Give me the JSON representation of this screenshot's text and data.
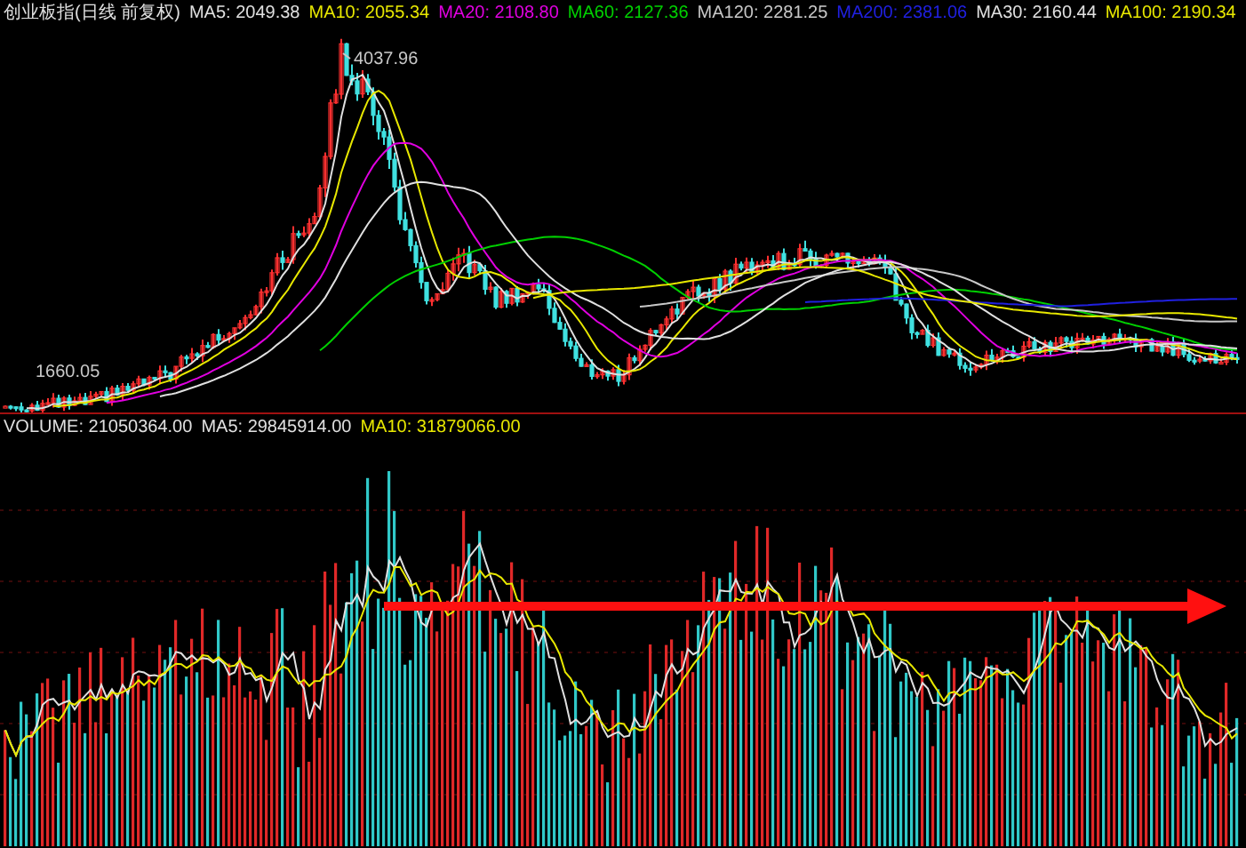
{
  "price_panel": {
    "title": "创业板指(日线 前复权)",
    "indicators": [
      {
        "label": "MA5:",
        "value": "2049.38",
        "color": "#e0e0e0"
      },
      {
        "label": "MA10:",
        "value": "2055.34",
        "color": "#e8e800"
      },
      {
        "label": "MA20:",
        "value": "2108.80",
        "color": "#e000e0"
      },
      {
        "label": "MA60:",
        "value": "2127.36",
        "color": "#00d000"
      },
      {
        "label": "MA120:",
        "value": "2281.25",
        "color": "#c8c8c8"
      },
      {
        "label": "MA200:",
        "value": "2381.06",
        "color": "#2020e0"
      },
      {
        "label": "MA30:",
        "value": "2160.44",
        "color": "#e0e0e0"
      },
      {
        "label": "MA100:",
        "value": "2190.34",
        "color": "#e8e800"
      }
    ],
    "high_label": "4037.96",
    "low_label": "1660.05"
  },
  "volume_panel": {
    "title": "VOLUME: 21050364.00",
    "indicators": [
      {
        "label": "MA5:",
        "value": "29845914.00",
        "color": "#e0e0e0"
      },
      {
        "label": "MA10:",
        "value": "31879066.00",
        "color": "#e8e800"
      }
    ]
  }
}
